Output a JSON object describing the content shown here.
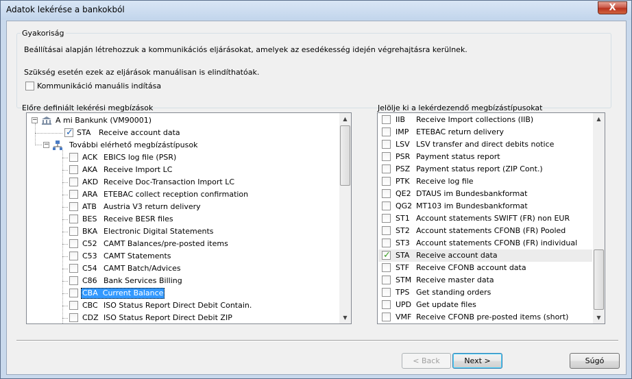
{
  "window": {
    "title": "Adatok lekérése a bankokból",
    "close_glyph": "X"
  },
  "frequency": {
    "label": "Gyakoriság",
    "line1": "Beállításai alapján létrehozzuk a kommunikációs eljárásokat, amelyek az esedékesség idején végrehajtásra kerülnek.",
    "line2": "Szükség esetén ezek az eljárások manuálisan is elindíthatóak.",
    "manual_label": "Kommunikáció manuális indítása",
    "manual_checked": false
  },
  "left_panel": {
    "label": "Előre definiált lekérési megbízások",
    "bank": "A mi Bankunk (VM90001)",
    "sta": {
      "code": "STA",
      "desc": "Receive account data",
      "checked": true
    },
    "group": "További elérhető megbízástípusok",
    "items": [
      {
        "code": "ACK",
        "desc": "EBICS log file (PSR)"
      },
      {
        "code": "AKA",
        "desc": "Receive Import LC"
      },
      {
        "code": "AKD",
        "desc": "Receive Doc-Transaction Import LC"
      },
      {
        "code": "ARA",
        "desc": "ETEBAC collect reception confirmation"
      },
      {
        "code": "ATB",
        "desc": "Austria V3 return delivery"
      },
      {
        "code": "BES",
        "desc": "Receive BESR files"
      },
      {
        "code": "BKA",
        "desc": "Electronic Digital Statements"
      },
      {
        "code": "C52",
        "desc": "CAMT Balances/pre-posted items"
      },
      {
        "code": "C53",
        "desc": "CAMT Statements"
      },
      {
        "code": "C54",
        "desc": "CAMT Batch/Advices"
      },
      {
        "code": "C86",
        "desc": "Bank Services Billing"
      },
      {
        "code": "CBA",
        "desc": "Current Balance",
        "selected": true
      },
      {
        "code": "CBC",
        "desc": "ISO Status Report Direct Debit Contain."
      },
      {
        "code": "CDZ",
        "desc": "ISO Status Report Direct Debit ZIP"
      }
    ]
  },
  "right_panel": {
    "label": "Jelölje ki a lekérdezendő megbízástípusokat",
    "items": [
      {
        "code": "IIB",
        "desc": "Receive Import collections (IIB)"
      },
      {
        "code": "IMP",
        "desc": "ETEBAC return delivery"
      },
      {
        "code": "LSV",
        "desc": "LSV transfer and direct debits notice"
      },
      {
        "code": "PSR",
        "desc": "Payment status report"
      },
      {
        "code": "PSZ",
        "desc": "Payment status report (ZIP Cont.)"
      },
      {
        "code": "PTK",
        "desc": "Receive log file"
      },
      {
        "code": "QE2",
        "desc": "DTAUS im Bundesbankformat"
      },
      {
        "code": "QG2",
        "desc": "MT103 im Bundesbankformat"
      },
      {
        "code": "ST1",
        "desc": "Account statements SWIFT (FR) non EUR"
      },
      {
        "code": "ST2",
        "desc": "Account statements CFONB (FR) Pooled"
      },
      {
        "code": "ST3",
        "desc": "Account statements CFONB (FR) individual"
      },
      {
        "code": "STA",
        "desc": "Receive account data",
        "checked": true
      },
      {
        "code": "STF",
        "desc": "Receive CFONB account data"
      },
      {
        "code": "STM",
        "desc": "Receive master data"
      },
      {
        "code": "TPS",
        "desc": "Get standing orders"
      },
      {
        "code": "UPD",
        "desc": "Get update files"
      },
      {
        "code": "VMF",
        "desc": "Receive CFONB pre-posted items (short)"
      }
    ]
  },
  "buttons": {
    "back": "< Back",
    "next": "Next >",
    "help": "Súgó"
  },
  "icons": {
    "bank": "bank-icon",
    "network": "network-icon",
    "check": "check-icon",
    "scroll_up": "scroll-up-icon",
    "scroll_down": "scroll-down-icon"
  },
  "colors": {
    "selection": "#3399ff",
    "check_blue": "#1b5fb5",
    "check_green": "#3a9d23"
  }
}
